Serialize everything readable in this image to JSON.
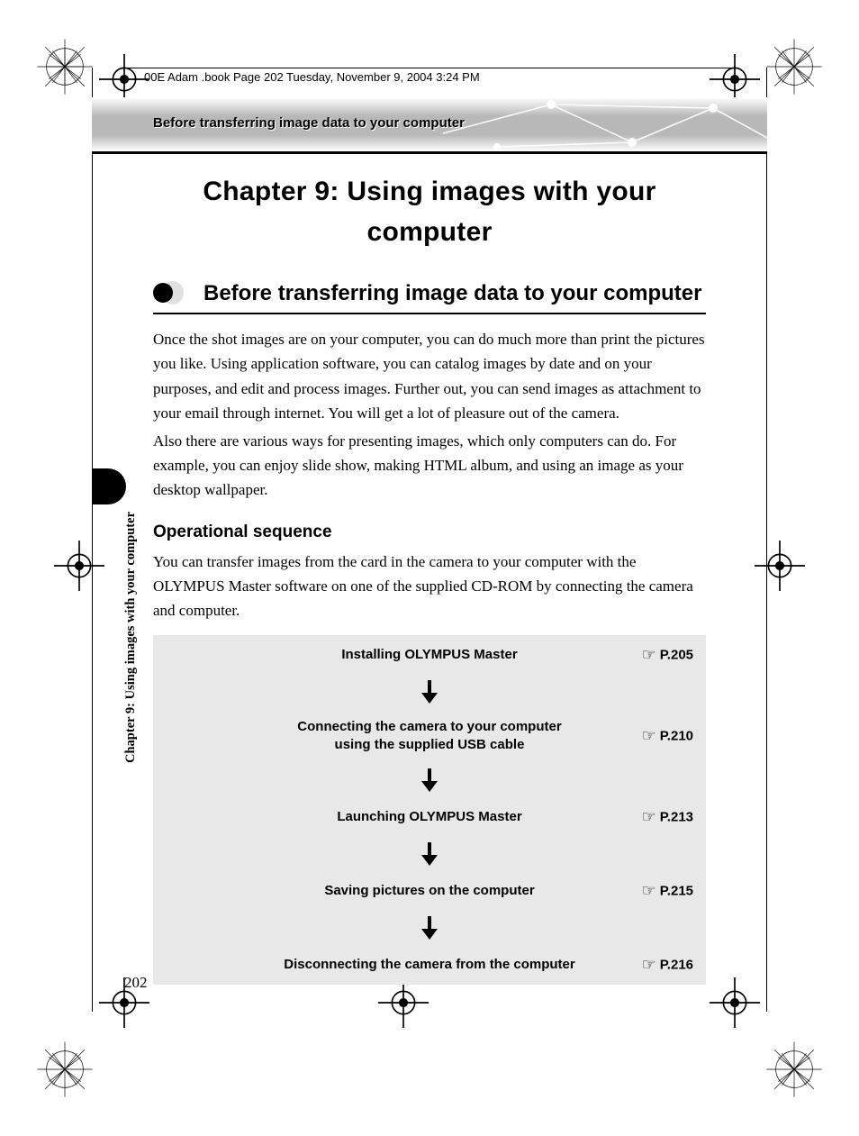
{
  "doc_meta": "00E Adam .book  Page 202  Tuesday, November 9, 2004  3:24 PM",
  "band_title": "Before transferring image data to your computer",
  "chapter_title": "Chapter 9:   Using images with your computer",
  "section_title": "Before transferring image data to your computer",
  "para1": "Once the shot images are on your computer, you can do much more than print the pictures you like. Using application software, you can catalog images by date and on your purposes, and edit and process images. Further out, you can send images as attachment to your email through internet. You will get a lot of pleasure out of the camera.",
  "para2": "Also there are various ways for presenting images, which only computers can do. For example, you can enjoy slide show, making HTML album, and using an image as your desktop wallpaper.",
  "subhead": "Operational sequence",
  "para3": "You can transfer images from the card in the camera to your computer with the OLYMPUS Master software on one of the supplied CD-ROM by connecting the camera and computer.",
  "ref_glyph": "☞",
  "steps": [
    {
      "label": "Installing OLYMPUS Master",
      "page": "P.205"
    },
    {
      "label": "Connecting the camera to your computer\nusing the supplied USB cable",
      "page": "P.210"
    },
    {
      "label": "Launching OLYMPUS Master",
      "page": "P.213"
    },
    {
      "label": "Saving pictures on the computer",
      "page": "P.215"
    },
    {
      "label": "Disconnecting the camera from the computer",
      "page": "P.216"
    }
  ],
  "side_label": "Chapter 9: Using images with your computer",
  "page_number": "202"
}
